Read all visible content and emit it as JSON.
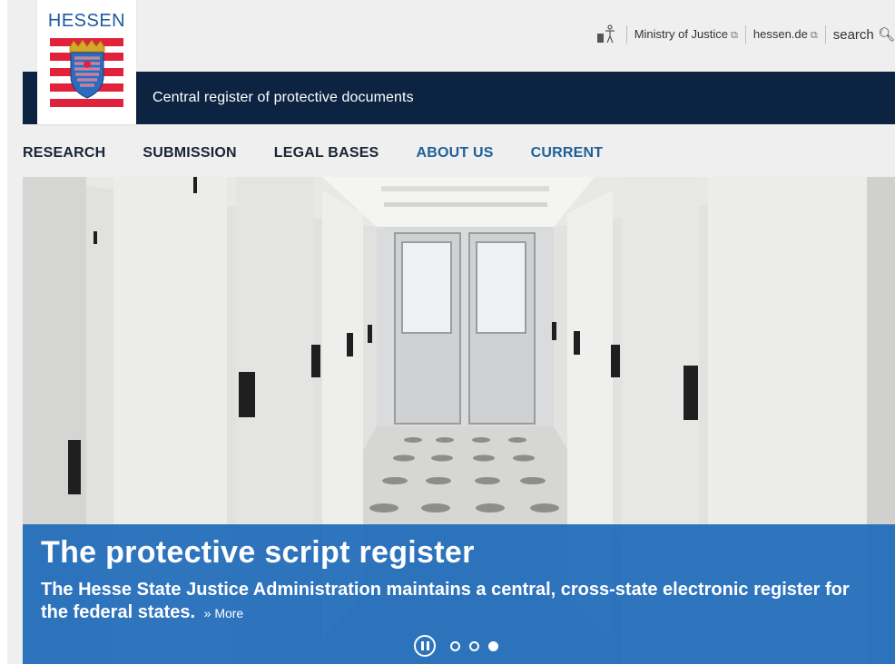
{
  "logo": {
    "text": "HESSEN"
  },
  "header": {
    "subtitle": "Central register of protective documents"
  },
  "toplinks": {
    "accessibility_icon": "accessibility-icon",
    "ministry": "Ministry of Justice",
    "hessen": "hessen.de",
    "external_icon": "external-link-icon",
    "search": "search",
    "search_icon": "magnifier-icon"
  },
  "nav": {
    "items": [
      {
        "label": "RESEARCH"
      },
      {
        "label": "SUBMISSION"
      },
      {
        "label": "LEGAL BASES"
      },
      {
        "label": "ABOUT US"
      },
      {
        "label": "CURRENT"
      }
    ]
  },
  "hero": {
    "title": "The protective script register",
    "text": "The Hesse State Justice Administration maintains a central, cross-state electronic register for the federal states.",
    "more": "» More",
    "slides": {
      "count": 3,
      "active_index": 3
    }
  },
  "colors": {
    "navy": "#0d2342",
    "caption_blue": "#206cba",
    "nav_blue": "#1f5f99",
    "logo_blue": "#1f5aa0",
    "logo_red": "#e0223a"
  }
}
